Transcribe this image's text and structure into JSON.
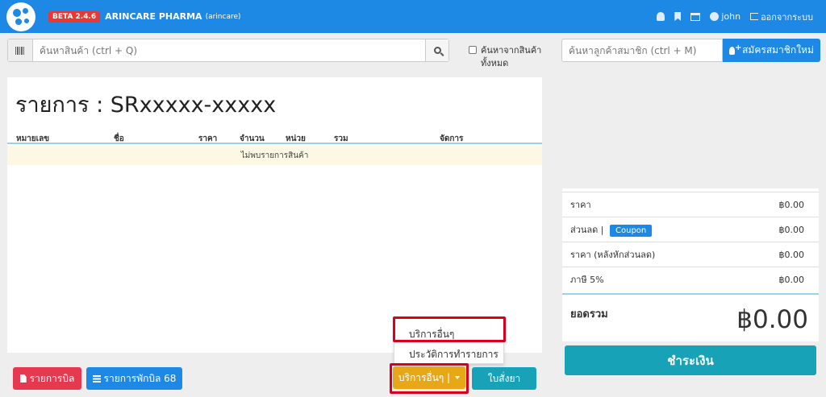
{
  "header": {
    "beta_badge": "BETA 2.4.6",
    "brand": "ARINCARE PHARMA",
    "brand_sub": "(arincare)",
    "username": "john",
    "logout_label": "ออกจากระบบ",
    "bg_color": "#1e88e5"
  },
  "search": {
    "placeholder": "ค้นหาสินค้า (ctrl + Q)",
    "search_all_label": "ค้นหาจากสินค้าทั้งหมด"
  },
  "member": {
    "placeholder": "ค้นหาลูกค้าสมาชิก (ctrl + M)",
    "register_label": "สมัครสมาชิกใหม่"
  },
  "order": {
    "title": "รายการ : SRxxxxx-xxxxx",
    "columns": [
      "หมายเลข",
      "ชื่อ",
      "ราคา",
      "จำนวน",
      "หน่วย",
      "รวม",
      "จัดการ"
    ],
    "empty_message": "ไม่พบรายการสินค้า"
  },
  "bottom": {
    "bill_label": "รายการบิล",
    "hold_label": "รายการพักบิล 68",
    "services_label": "บริการอื่นๆ |",
    "rx_label": "ใบสั่งยา"
  },
  "dropdown": {
    "items": [
      "บริการอื่นๆ",
      "ประวัติการทำรายการ"
    ]
  },
  "summary": {
    "rows": [
      {
        "label": "ราคา",
        "value": "฿0.00"
      },
      {
        "label": "ส่วนลด |",
        "value": "฿0.00"
      },
      {
        "label": "ราคา (หลังหักส่วนลด)",
        "value": "฿0.00"
      },
      {
        "label": "ภาษี 5%",
        "value": "฿0.00"
      }
    ],
    "coupon_label": "Coupon",
    "total_label": "ยอดรวม",
    "total_value": "฿0.00",
    "pay_label": "ชำระเงิน"
  }
}
